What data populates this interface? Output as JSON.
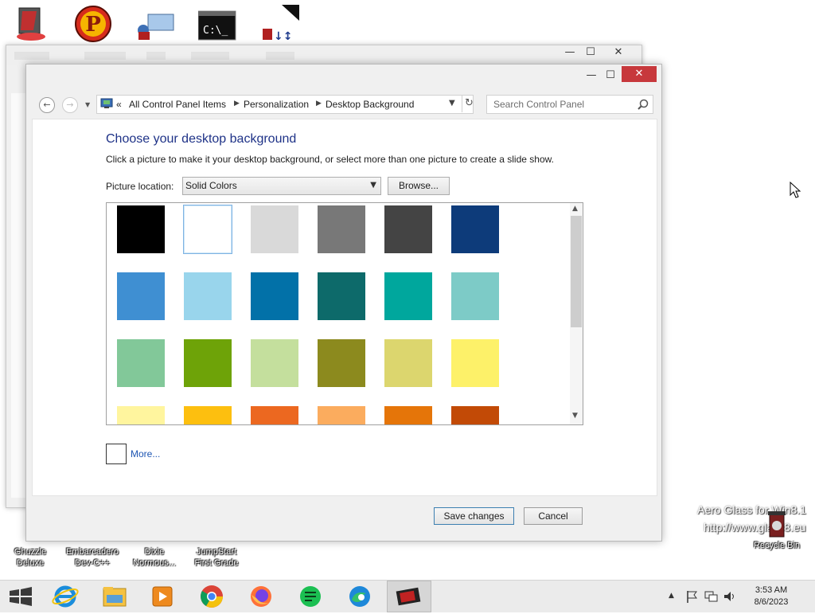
{
  "desktop": {
    "icons_bottom": [
      {
        "line1": "Ghuzzle",
        "line2": "Deluxe"
      },
      {
        "line1": "Embarcadero",
        "line2": "Dev-C++"
      },
      {
        "line1": "Dixie",
        "line2": "Normous..."
      },
      {
        "line1": "JumpStart",
        "line2": "First Grade"
      }
    ],
    "recycle_bin": "Recycle Bin",
    "watermark_line1": "Aero Glass for Win8.1",
    "watermark_line2": "http://www.glass8.eu"
  },
  "window": {
    "minimize": "—",
    "maximize": "☐",
    "close": "✕"
  },
  "nav": {
    "back": "←",
    "forward": "→",
    "breadcrumb_prefix": "«",
    "crumbs": [
      "All Control Panel Items",
      "Personalization",
      "Desktop Background"
    ],
    "search_placeholder": "Search Control Panel"
  },
  "page": {
    "heading": "Choose your desktop background",
    "subtitle": "Click a picture to make it your desktop background, or select more than one picture to create a slide show.",
    "picture_location_label": "Picture location:",
    "picture_location_value": "Solid Colors",
    "browse_label": "Browse...",
    "more_label": "More...",
    "save_label": "Save changes",
    "cancel_label": "Cancel"
  },
  "swatches": [
    [
      "#000000",
      "#ffffff",
      "#d9d9d9",
      "#787878",
      "#444444",
      "#0d3b7a"
    ],
    [
      "#3f8fd2",
      "#99d5ec",
      "#0271a8",
      "#0d6a6a",
      "#00a79d",
      "#7dcbc7"
    ],
    [
      "#82c899",
      "#6ea308",
      "#c4df9d",
      "#8c8a1e",
      "#dcd66e",
      "#fdf169"
    ],
    [
      "#fff59e",
      "#fdbf0f",
      "#ec6820",
      "#fbac5e",
      "#e57509",
      "#c24a06"
    ]
  ],
  "selected_swatch": "white",
  "taskbar": {
    "time": "3:53 AM",
    "date": "8/6/2023",
    "apps": [
      "start-icon",
      "internet-explorer-icon",
      "file-explorer-icon",
      "media-player-icon",
      "chrome-icon",
      "firefox-icon",
      "sheets-icon",
      "edge-icon",
      "game-app-icon"
    ]
  }
}
